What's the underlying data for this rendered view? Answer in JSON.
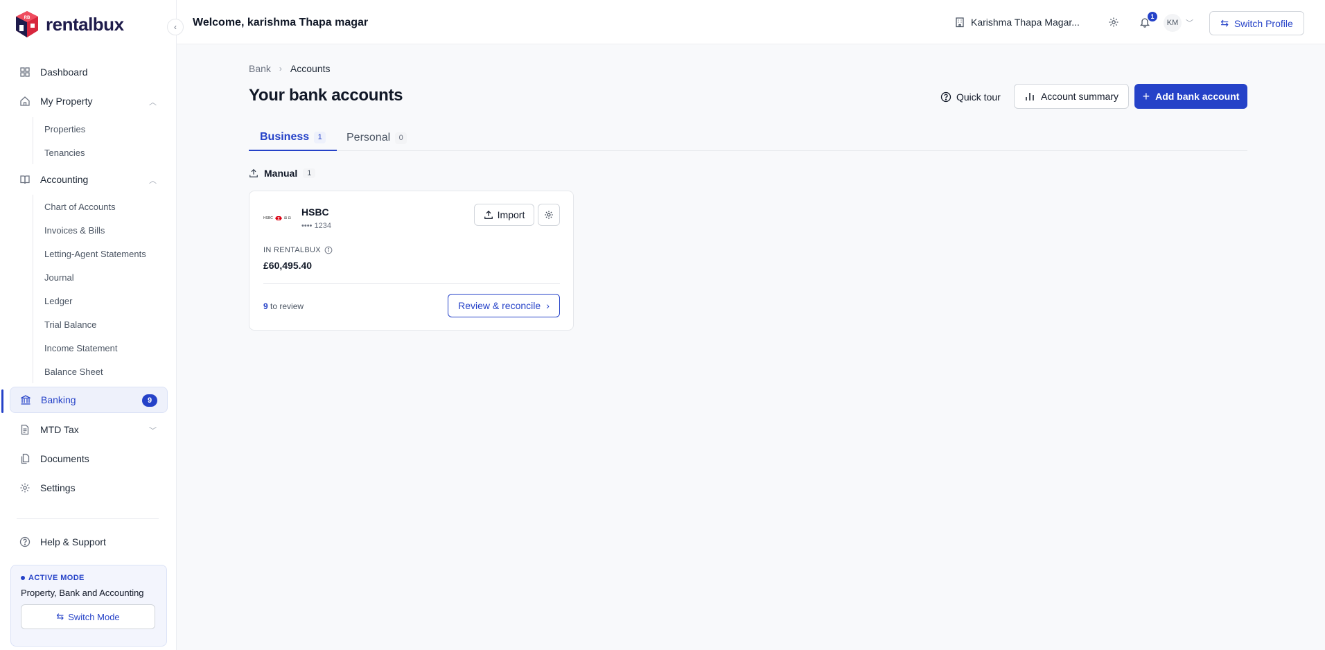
{
  "brand": {
    "name": "rentalbux"
  },
  "sidebar": {
    "dashboard": "Dashboard",
    "my_property": "My Property",
    "property_subitems": [
      "Properties",
      "Tenancies"
    ],
    "accounting": "Accounting",
    "accounting_subitems": [
      "Chart of Accounts",
      "Invoices & Bills",
      "Letting-Agent Statements",
      "Journal",
      "Ledger",
      "Trial Balance",
      "Income Statement",
      "Balance Sheet"
    ],
    "banking": "Banking",
    "banking_badge": "9",
    "mtd_tax": "MTD Tax",
    "documents": "Documents",
    "settings": "Settings",
    "help": "Help & Support",
    "mode": {
      "tag": "ACTIVE MODE",
      "name": "Property, Bank and Accounting",
      "switch_label": "Switch Mode"
    }
  },
  "header": {
    "welcome": "Welcome, karishma Thapa magar",
    "org_name": "Karishma Thapa Magar...",
    "notification_count": "1",
    "avatar_initials": "KM",
    "switch_profile": "Switch Profile"
  },
  "breadcrumb": {
    "parent": "Bank",
    "current": "Accounts"
  },
  "page": {
    "title": "Your bank accounts",
    "quick_tour": "Quick tour",
    "account_summary": "Account summary",
    "add_bank_account": "Add bank account"
  },
  "tabs": [
    {
      "label": "Business",
      "count": "1"
    },
    {
      "label": "Personal",
      "count": "0"
    }
  ],
  "section": {
    "label": "Manual",
    "count": "1"
  },
  "account_card": {
    "bank_name": "HSBC",
    "masked_number": "•••• 1234",
    "import_label": "Import",
    "in_label": "IN RENTALBUX",
    "balance": "£60,495.40",
    "review_count": "9",
    "review_suffix": "to review",
    "reconcile_label": "Review & reconcile"
  },
  "colors": {
    "accent": "#2542c8",
    "logo_red": "#d7263d",
    "hsbc_red": "#db0011"
  }
}
